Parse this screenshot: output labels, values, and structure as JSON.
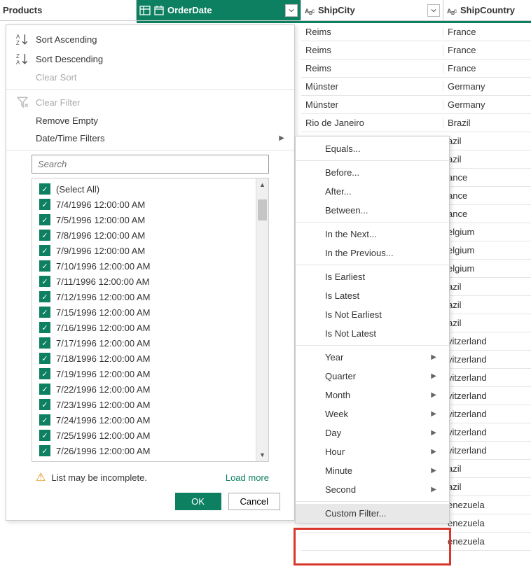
{
  "columns": {
    "products": "Products",
    "orderdate": "OrderDate",
    "shipcity": "ShipCity",
    "shipcountry": "ShipCountry"
  },
  "filter_menu": {
    "sort_asc": "Sort Ascending",
    "sort_desc": "Sort Descending",
    "clear_sort": "Clear Sort",
    "clear_filter": "Clear Filter",
    "remove_empty": "Remove Empty",
    "datetime_filters": "Date/Time Filters",
    "search_placeholder": "Search",
    "select_all": "(Select All)",
    "values": [
      "7/4/1996 12:00:00 AM",
      "7/5/1996 12:00:00 AM",
      "7/8/1996 12:00:00 AM",
      "7/9/1996 12:00:00 AM",
      "7/10/1996 12:00:00 AM",
      "7/11/1996 12:00:00 AM",
      "7/12/1996 12:00:00 AM",
      "7/15/1996 12:00:00 AM",
      "7/16/1996 12:00:00 AM",
      "7/17/1996 12:00:00 AM",
      "7/18/1996 12:00:00 AM",
      "7/19/1996 12:00:00 AM",
      "7/22/1996 12:00:00 AM",
      "7/23/1996 12:00:00 AM",
      "7/24/1996 12:00:00 AM",
      "7/25/1996 12:00:00 AM",
      "7/26/1996 12:00:00 AM"
    ],
    "incomplete_msg": "List may be incomplete.",
    "load_more": "Load more",
    "ok": "OK",
    "cancel": "Cancel"
  },
  "submenu": {
    "equals": "Equals...",
    "before": "Before...",
    "after": "After...",
    "between": "Between...",
    "in_next": "In the Next...",
    "in_prev": "In the Previous...",
    "is_earliest": "Is Earliest",
    "is_latest": "Is Latest",
    "is_not_earliest": "Is Not Earliest",
    "is_not_latest": "Is Not Latest",
    "year": "Year",
    "quarter": "Quarter",
    "month": "Month",
    "week": "Week",
    "day": "Day",
    "hour": "Hour",
    "minute": "Minute",
    "second": "Second",
    "custom": "Custom Filter..."
  },
  "rows": [
    {
      "city": "Reims",
      "country": "France"
    },
    {
      "city": "Reims",
      "country": "France"
    },
    {
      "city": "Reims",
      "country": "France"
    },
    {
      "city": "Münster",
      "country": "Germany"
    },
    {
      "city": "Münster",
      "country": "Germany"
    },
    {
      "city": "Rio de Janeiro",
      "country": "Brazil"
    },
    {
      "city": "",
      "country": "azil"
    },
    {
      "city": "",
      "country": "azil"
    },
    {
      "city": "",
      "country": "ance"
    },
    {
      "city": "",
      "country": "ance"
    },
    {
      "city": "",
      "country": "ance"
    },
    {
      "city": "",
      "country": "elgium"
    },
    {
      "city": "",
      "country": "elgium"
    },
    {
      "city": "",
      "country": "elgium"
    },
    {
      "city": "",
      "country": "azil"
    },
    {
      "city": "",
      "country": "azil"
    },
    {
      "city": "",
      "country": "azil"
    },
    {
      "city": "",
      "country": "vitzerland"
    },
    {
      "city": "",
      "country": "vitzerland"
    },
    {
      "city": "",
      "country": "vitzerland"
    },
    {
      "city": "",
      "country": "vitzerland"
    },
    {
      "city": "",
      "country": "vitzerland"
    },
    {
      "city": "",
      "country": "vitzerland"
    },
    {
      "city": "",
      "country": "vitzerland"
    },
    {
      "city": "",
      "country": "azil"
    },
    {
      "city": "",
      "country": "azil"
    },
    {
      "city": "",
      "country": "enezuela"
    },
    {
      "city": "",
      "country": "enezuela"
    },
    {
      "city": "",
      "country": "enezuela"
    }
  ]
}
